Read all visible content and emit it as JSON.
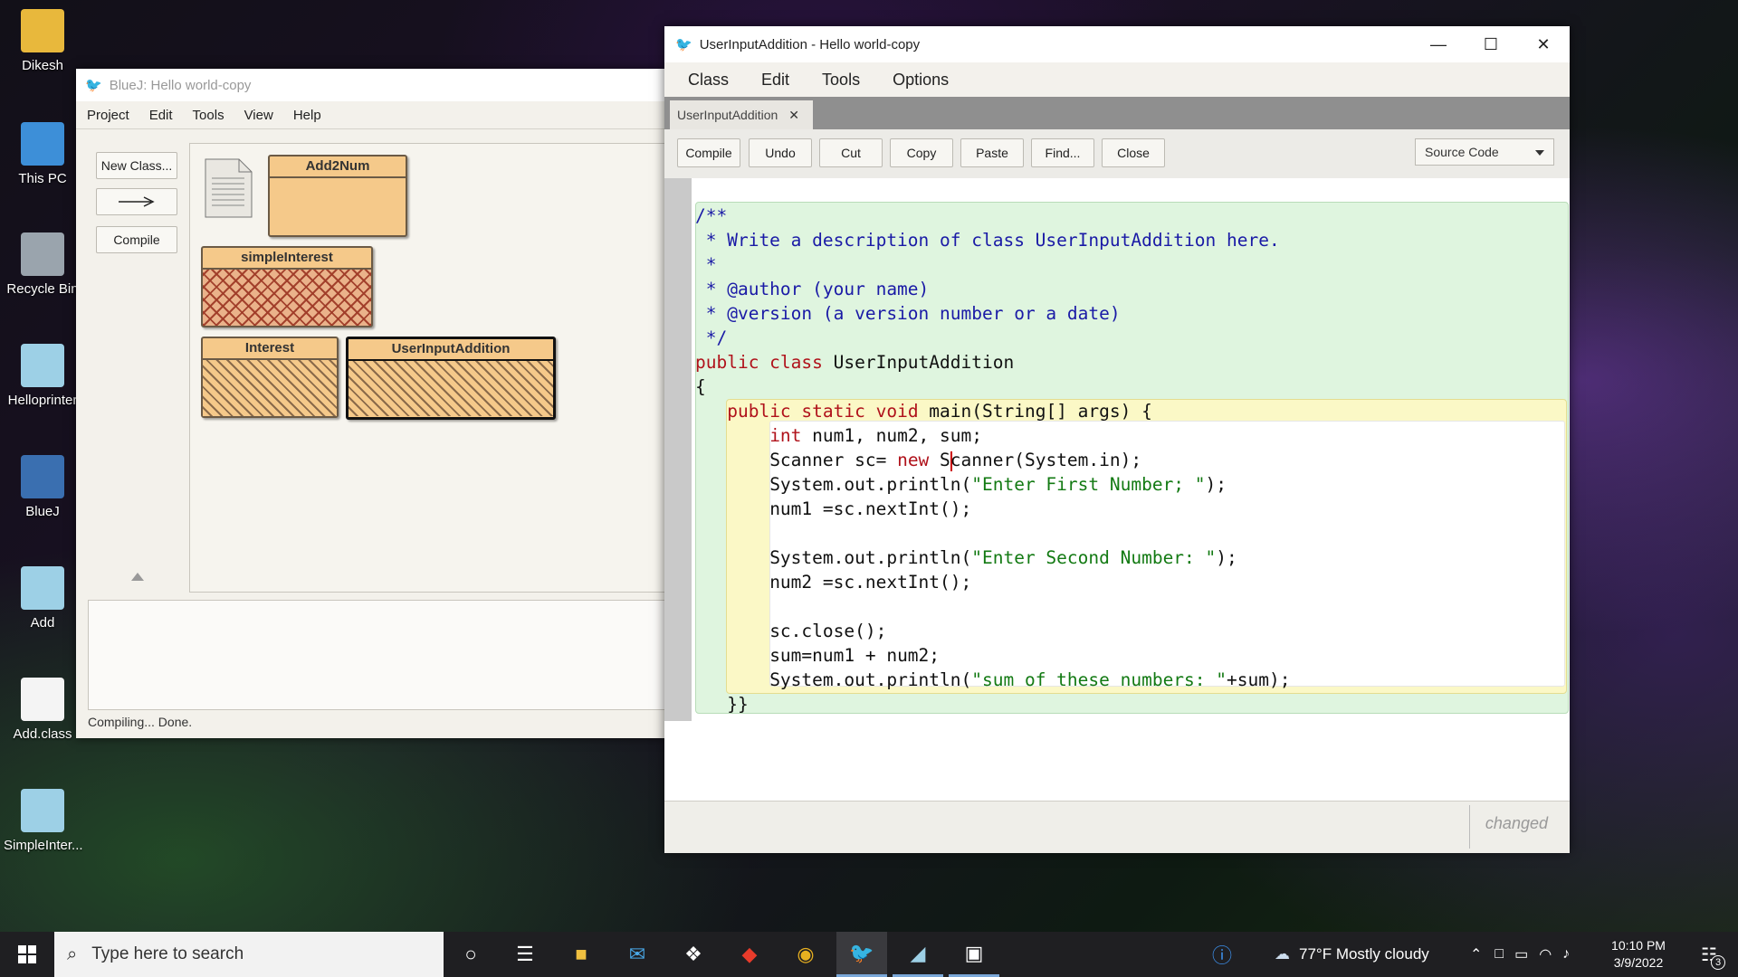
{
  "desktop": {
    "icons": [
      "Dikesh",
      "This PC",
      "Recycle Bin",
      "Helloprinter",
      "BlueJ",
      "Add",
      "Add.class",
      "SimpleInter..."
    ]
  },
  "bluej": {
    "title": "BlueJ:  Hello world-copy",
    "menu": [
      "Project",
      "Edit",
      "Tools",
      "View",
      "Help"
    ],
    "new_class": "New Class...",
    "compile": "Compile",
    "classes": [
      "Add2Num",
      "simpleInterest",
      "Interest",
      "UserInputAddition"
    ],
    "status": "Compiling... Done."
  },
  "editor": {
    "title": "UserInputAddition - Hello world-copy",
    "menu": [
      "Class",
      "Edit",
      "Tools",
      "Options"
    ],
    "tab": "UserInputAddition",
    "toolbar": [
      "Compile",
      "Undo",
      "Cut",
      "Copy",
      "Paste",
      "Find...",
      "Close"
    ],
    "view_select": "Source Code",
    "status": "changed",
    "code": {
      "l1": "/**",
      "l2": " * Write a description of class UserInputAddition here.",
      "l3": " *",
      "l4": " * @author (your name)",
      "l5": " * @version (a version number or a date)",
      "l6": " */",
      "l7_kw": "public class",
      "l7_rest": " UserInputAddition",
      "l8": "{",
      "l9_kw": "public static void",
      "l9_rest": " main(String[] args) {",
      "l10_kw": "int",
      "l10_rest": " num1, num2, sum;",
      "l11_a": "Scanner sc= ",
      "l11_kw": "new",
      "l11_b": " S",
      "l11_c": "canner(System.in);",
      "l12_a": "System.out.println(",
      "l12_st": "\"Enter First Number; \"",
      "l12_b": ");",
      "l13": "num1 =sc.nextInt();",
      "l15_a": "System.out.println(",
      "l15_st": "\"Enter Second Number: \"",
      "l15_b": ");",
      "l16": "num2 =sc.nextInt();",
      "l18": "sc.close();",
      "l19": "sum=num1 + num2;",
      "l20_a": "System.out.println(",
      "l20_st": "\"sum of these numbers: \"",
      "l20_b": "+sum);",
      "l21": "}}"
    }
  },
  "taskbar": {
    "search": "Type here to search",
    "weather": "77°F  Mostly cloudy",
    "time": "10:10 PM",
    "date": "3/9/2022",
    "notifications": "3"
  }
}
